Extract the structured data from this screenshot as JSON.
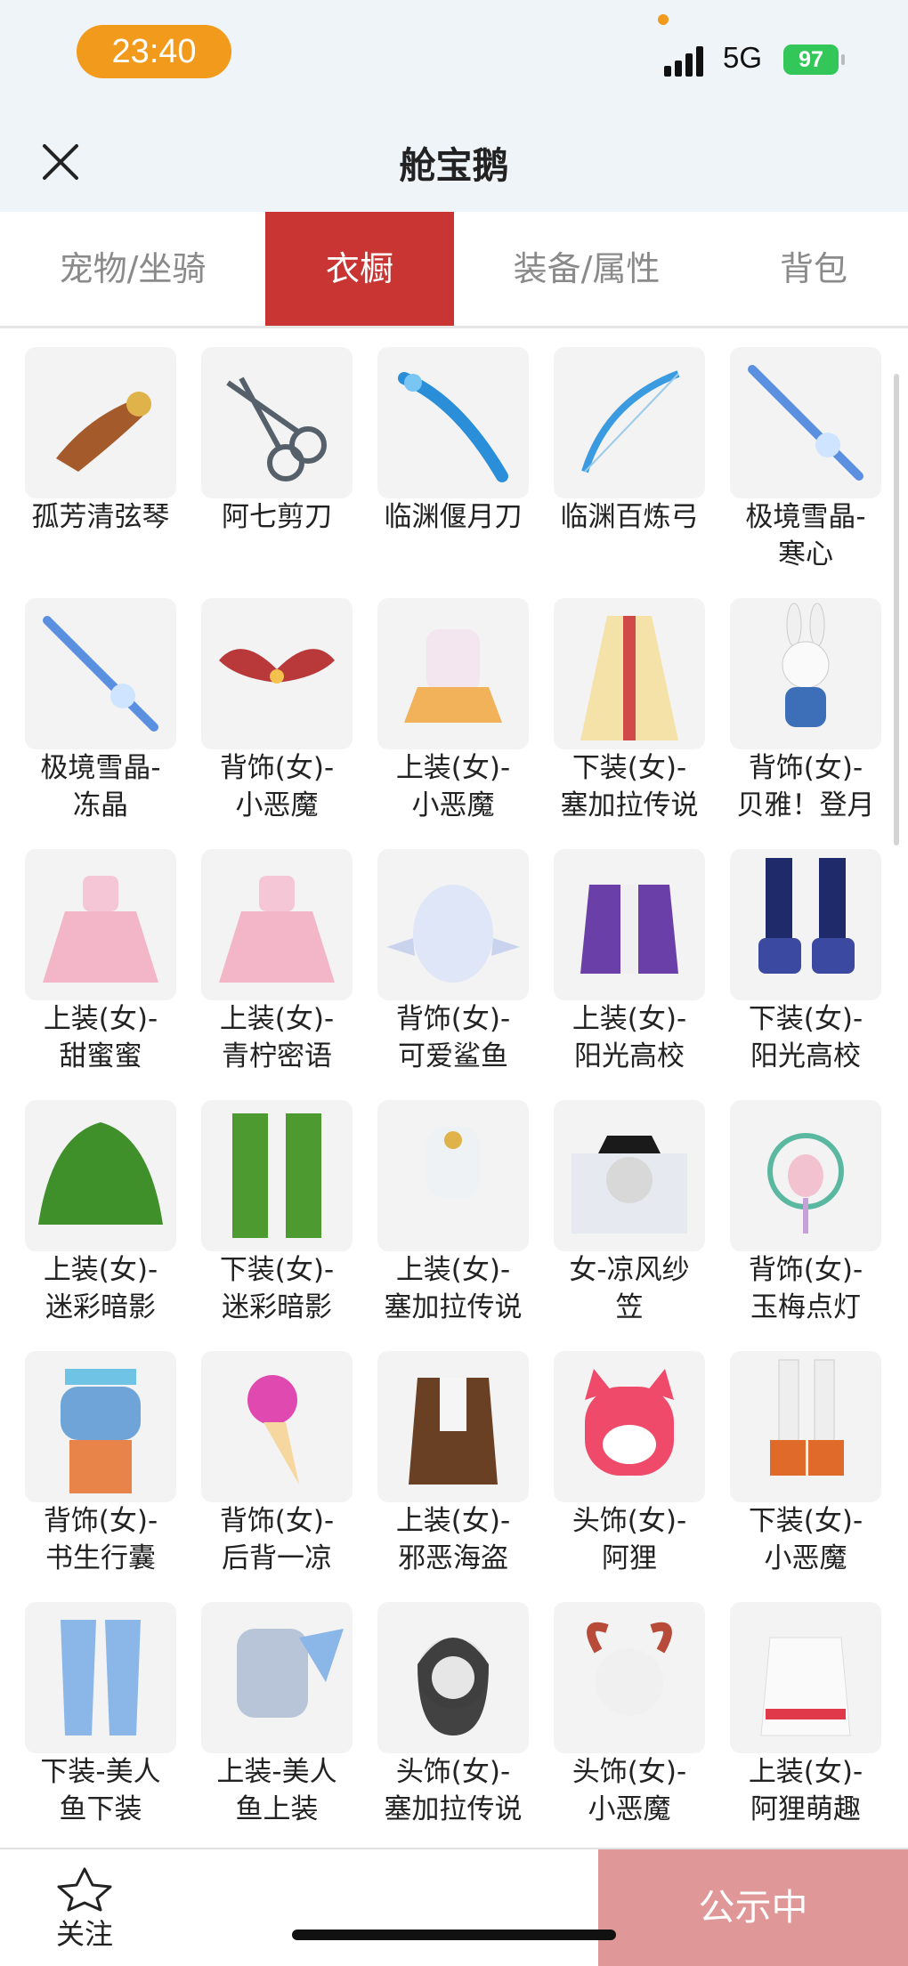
{
  "status": {
    "time": "23:40",
    "network": "5G",
    "battery": "97"
  },
  "nav": {
    "title": "舱宝鹅",
    "close_icon": "close-icon"
  },
  "tabs": [
    {
      "label": "宠物/坐骑",
      "active": false
    },
    {
      "label": "衣橱",
      "active": true
    },
    {
      "label": "装备/属性",
      "active": false
    },
    {
      "label": "背包",
      "active": false
    }
  ],
  "items": [
    {
      "line1": "孤芳清弦琴",
      "line2": "",
      "icon": "lute-icon"
    },
    {
      "line1": "阿七剪刀",
      "line2": "",
      "icon": "scissors-icon"
    },
    {
      "line1": "临渊偃月刀",
      "line2": "",
      "icon": "blade-icon"
    },
    {
      "line1": "临渊百炼弓",
      "line2": "",
      "icon": "bow-icon"
    },
    {
      "line1": "极境雪晶-",
      "line2": "寒心",
      "icon": "ice-sword-icon"
    },
    {
      "line1": "极境雪晶-",
      "line2": "冻晶",
      "icon": "ice-sword-icon"
    },
    {
      "line1": "背饰(女)-",
      "line2": "小恶魔",
      "icon": "wings-icon"
    },
    {
      "line1": "上装(女)-",
      "line2": "小恶魔",
      "icon": "outfit-icon"
    },
    {
      "line1": "下装(女)-",
      "line2": "塞加拉传说",
      "icon": "robe-icon"
    },
    {
      "line1": "背饰(女)-",
      "line2": "贝雅！登月",
      "icon": "bunny-icon"
    },
    {
      "line1": "上装(女)-",
      "line2": "甜蜜蜜",
      "icon": "dress-icon"
    },
    {
      "line1": "上装(女)-",
      "line2": "青柠密语",
      "icon": "dress-icon"
    },
    {
      "line1": "背饰(女)-",
      "line2": "可爱鲨鱼",
      "icon": "shark-icon"
    },
    {
      "line1": "上装(女)-",
      "line2": "阳光高校",
      "icon": "jacket-icon"
    },
    {
      "line1": "下装(女)-",
      "line2": "阳光高校",
      "icon": "boots-icon"
    },
    {
      "line1": "上装(女)-",
      "line2": "迷彩暗影",
      "icon": "ghillie-icon"
    },
    {
      "line1": "下装(女)-",
      "line2": "迷彩暗影",
      "icon": "ghillie-pants-icon"
    },
    {
      "line1": "上装(女)-",
      "line2": "塞加拉传说",
      "icon": "top-icon"
    },
    {
      "line1": "女-凉风纱",
      "line2": "笠",
      "icon": "veil-hat-icon"
    },
    {
      "line1": "背饰(女)-",
      "line2": "玉梅点灯",
      "icon": "lantern-icon"
    },
    {
      "line1": "背饰(女)-",
      "line2": "书生行囊",
      "icon": "backpack-icon"
    },
    {
      "line1": "背饰(女)-",
      "line2": "后背一凉",
      "icon": "icecream-icon"
    },
    {
      "line1": "上装(女)-",
      "line2": "邪恶海盗",
      "icon": "pirate-icon"
    },
    {
      "line1": "头饰(女)-",
      "line2": "阿狸",
      "icon": "fox-head-icon"
    },
    {
      "line1": "下装(女)-",
      "line2": "小恶魔",
      "icon": "legs-icon"
    },
    {
      "line1": "下装-美人",
      "line2": "鱼下装",
      "icon": "mermaid-pants-icon"
    },
    {
      "line1": "上装-美人",
      "line2": "鱼上装",
      "icon": "mermaid-top-icon"
    },
    {
      "line1": "头饰(女)-",
      "line2": "塞加拉传说",
      "icon": "head-icon"
    },
    {
      "line1": "头饰(女)-",
      "line2": "小恶魔",
      "icon": "horns-head-icon"
    },
    {
      "line1": "上装(女)-",
      "line2": "阿狸萌趣",
      "icon": "hoodie-icon"
    }
  ],
  "bottom": {
    "follow_label": "关注",
    "public_label": "公示中"
  },
  "colors": {
    "accent": "#c93532",
    "public_button": "#e09797",
    "time_pill": "#f29a1b"
  }
}
